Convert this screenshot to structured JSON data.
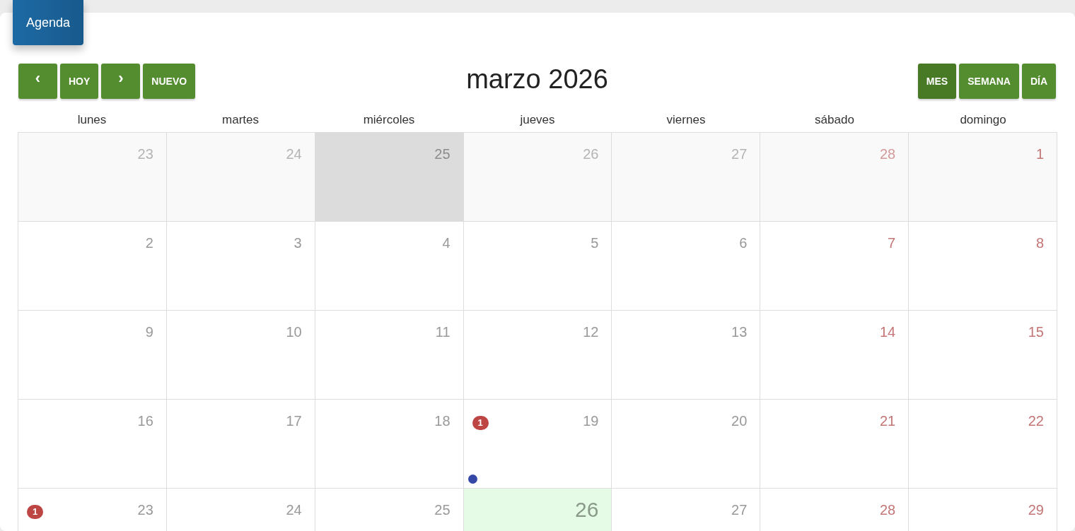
{
  "tab": {
    "label": "Agenda"
  },
  "nav_buttons": [
    {
      "label": "‹",
      "kind": "icon"
    },
    {
      "label": "HOY",
      "kind": "text"
    },
    {
      "label": "›",
      "kind": "icon"
    },
    {
      "label": "NUEVO",
      "kind": "text"
    }
  ],
  "title": "marzo 2026",
  "view_buttons": [
    {
      "label": "MES",
      "selected": true
    },
    {
      "label": "SEMANA",
      "selected": false
    },
    {
      "label": "DÍA",
      "selected": false
    }
  ],
  "weekdays": [
    "lunes",
    "martes",
    "miércoles",
    "jueves",
    "viernes",
    "sábado",
    "domingo"
  ],
  "weeks": [
    [
      {
        "day": "23",
        "other_month": true,
        "weekend": false,
        "today": false,
        "selected": false
      },
      {
        "day": "24",
        "other_month": true,
        "weekend": false,
        "today": false,
        "selected": false
      },
      {
        "day": "25",
        "other_month": true,
        "weekend": false,
        "today": false,
        "selected": true
      },
      {
        "day": "26",
        "other_month": true,
        "weekend": false,
        "today": false,
        "selected": false
      },
      {
        "day": "27",
        "other_month": true,
        "weekend": false,
        "today": false,
        "selected": false
      },
      {
        "day": "28",
        "other_month": true,
        "weekend": true,
        "today": false,
        "selected": false
      },
      {
        "day": "1",
        "other_month": false,
        "weekend": true,
        "today": false,
        "selected": false,
        "faded_bg": true
      }
    ],
    [
      {
        "day": "2",
        "other_month": false,
        "weekend": false,
        "today": false,
        "selected": false
      },
      {
        "day": "3",
        "other_month": false,
        "weekend": false,
        "today": false,
        "selected": false
      },
      {
        "day": "4",
        "other_month": false,
        "weekend": false,
        "today": false,
        "selected": false
      },
      {
        "day": "5",
        "other_month": false,
        "weekend": false,
        "today": false,
        "selected": false
      },
      {
        "day": "6",
        "other_month": false,
        "weekend": false,
        "today": false,
        "selected": false
      },
      {
        "day": "7",
        "other_month": false,
        "weekend": true,
        "today": false,
        "selected": false
      },
      {
        "day": "8",
        "other_month": false,
        "weekend": true,
        "today": false,
        "selected": false
      }
    ],
    [
      {
        "day": "9",
        "other_month": false,
        "weekend": false,
        "today": false,
        "selected": false
      },
      {
        "day": "10",
        "other_month": false,
        "weekend": false,
        "today": false,
        "selected": false
      },
      {
        "day": "11",
        "other_month": false,
        "weekend": false,
        "today": false,
        "selected": false
      },
      {
        "day": "12",
        "other_month": false,
        "weekend": false,
        "today": false,
        "selected": false
      },
      {
        "day": "13",
        "other_month": false,
        "weekend": false,
        "today": false,
        "selected": false
      },
      {
        "day": "14",
        "other_month": false,
        "weekend": true,
        "today": false,
        "selected": false
      },
      {
        "day": "15",
        "other_month": false,
        "weekend": true,
        "today": false,
        "selected": false
      }
    ],
    [
      {
        "day": "16",
        "other_month": false,
        "weekend": false,
        "today": false,
        "selected": false
      },
      {
        "day": "17",
        "other_month": false,
        "weekend": false,
        "today": false,
        "selected": false
      },
      {
        "day": "18",
        "other_month": false,
        "weekend": false,
        "today": false,
        "selected": false
      },
      {
        "day": "19",
        "other_month": false,
        "weekend": false,
        "today": false,
        "selected": false,
        "badge": "1",
        "events": [
          {
            "color": "#3548a8"
          }
        ]
      },
      {
        "day": "20",
        "other_month": false,
        "weekend": false,
        "today": false,
        "selected": false
      },
      {
        "day": "21",
        "other_month": false,
        "weekend": true,
        "today": false,
        "selected": false
      },
      {
        "day": "22",
        "other_month": false,
        "weekend": true,
        "today": false,
        "selected": false
      }
    ],
    [
      {
        "day": "23",
        "other_month": false,
        "weekend": false,
        "today": false,
        "selected": false,
        "badge": "1"
      },
      {
        "day": "24",
        "other_month": false,
        "weekend": false,
        "today": false,
        "selected": false
      },
      {
        "day": "25",
        "other_month": false,
        "weekend": false,
        "today": false,
        "selected": false
      },
      {
        "day": "26",
        "other_month": false,
        "weekend": false,
        "today": true,
        "selected": false
      },
      {
        "day": "27",
        "other_month": false,
        "weekend": false,
        "today": false,
        "selected": false
      },
      {
        "day": "28",
        "other_month": false,
        "weekend": true,
        "today": false,
        "selected": false
      },
      {
        "day": "29",
        "other_month": false,
        "weekend": true,
        "today": false,
        "selected": false
      }
    ]
  ]
}
